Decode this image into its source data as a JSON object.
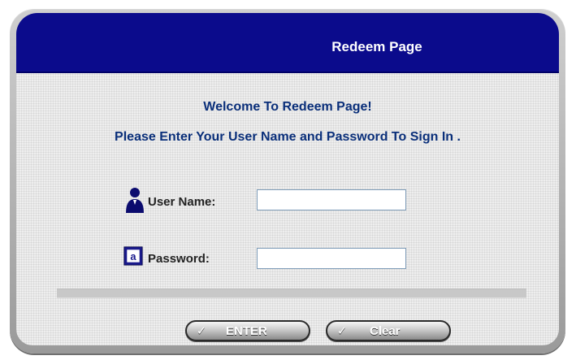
{
  "header": {
    "title": "Redeem Page"
  },
  "messages": {
    "welcome": "Welcome To Redeem Page!",
    "instruction": "Please Enter Your User Name and Password To Sign In ."
  },
  "form": {
    "username": {
      "label": "User Name:",
      "value": "",
      "placeholder": ""
    },
    "password": {
      "label": "Password:",
      "value": "",
      "placeholder": ""
    }
  },
  "buttons": {
    "enter": {
      "label": "ENTER",
      "icon": "check-icon"
    },
    "clear": {
      "label": "Clear",
      "icon": "check-icon"
    }
  },
  "colors": {
    "header_bg": "#0b0b8c",
    "text_blue": "#0a2f7a",
    "icon_navy": "#0b0b6e"
  }
}
